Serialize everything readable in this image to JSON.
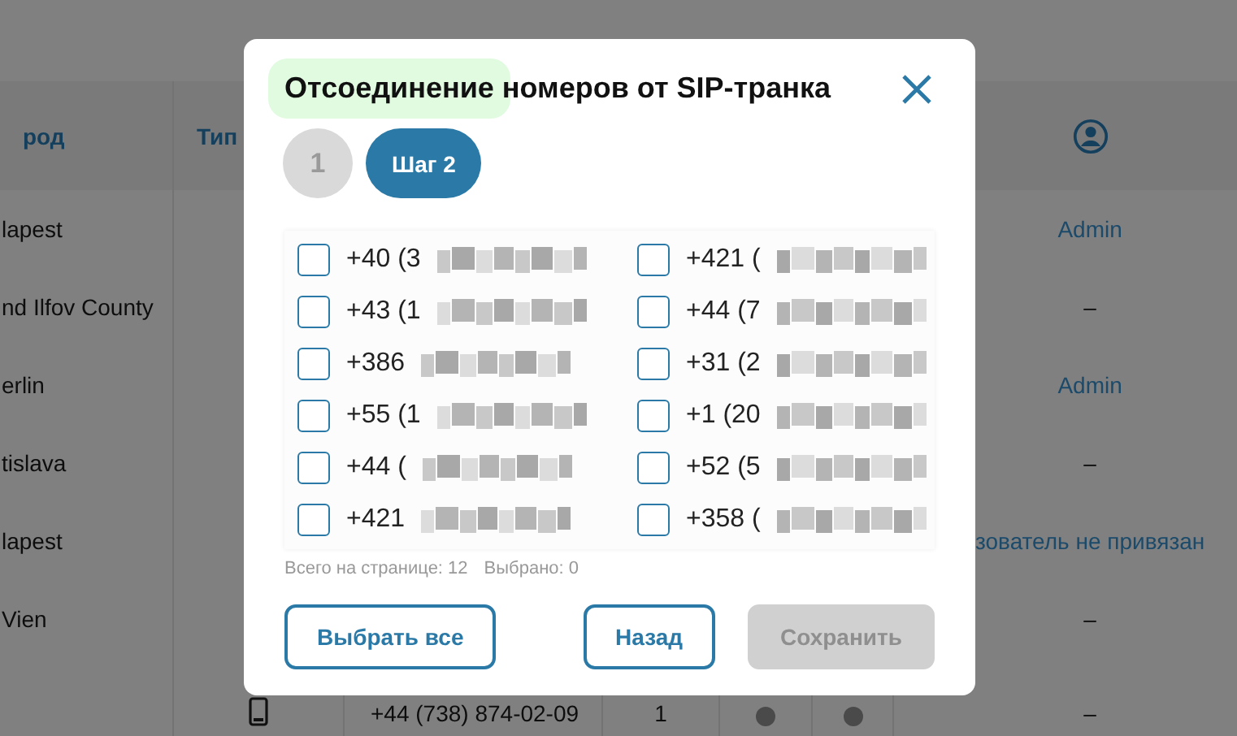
{
  "background_table": {
    "columns": [
      {
        "kind": "text",
        "label": "род"
      },
      {
        "kind": "text",
        "label": "Тип"
      },
      {
        "kind": "blank"
      },
      {
        "kind": "blank"
      },
      {
        "kind": "blank"
      },
      {
        "kind": "blank"
      },
      {
        "kind": "user-icon"
      }
    ],
    "rows": [
      {
        "city": "lapest",
        "user": "Admin"
      },
      {
        "city": "nd Ilfov County",
        "user": "–"
      },
      {
        "city": "erlin",
        "user": "Admin"
      },
      {
        "city": "tislava",
        "user": "–"
      },
      {
        "city": "lapest",
        "user": "зователь не привязан"
      },
      {
        "city": "Vien",
        "user": "–"
      },
      {
        "city": "",
        "phone_icon": true,
        "number": "+44 (738) 874-02-09",
        "count": "1",
        "user": "–"
      }
    ]
  },
  "dialog": {
    "title_parts": [
      {
        "text": "Отсоединение",
        "highlighted": true
      },
      {
        "text": " номеров от SIP-транка",
        "highlighted": false
      }
    ],
    "steps": [
      {
        "label": "1",
        "selected": false
      },
      {
        "label": "Шаг 2",
        "selected": true
      }
    ],
    "numbers": [
      {
        "text": "+40 (3",
        "checked": false
      },
      {
        "text": "+421 (",
        "checked": false
      },
      {
        "text": "+43 (1",
        "checked": false
      },
      {
        "text": "+44 (7",
        "checked": false
      },
      {
        "text": "+386",
        "checked": false
      },
      {
        "text": "+31 (2",
        "checked": false
      },
      {
        "text": "+55 (1",
        "checked": false
      },
      {
        "text": "+1 (20",
        "checked": false
      },
      {
        "text": "+44 (",
        "checked": false
      },
      {
        "text": "+52 (5",
        "checked": false
      },
      {
        "text": "+421",
        "checked": false
      },
      {
        "text": "+358 (",
        "checked": false
      }
    ],
    "total": "Всего на странице: 12",
    "selected_count": "Выбрано: 0",
    "buttons": [
      {
        "label": "Выбрать все",
        "disabled": false
      },
      {
        "label": "Назад",
        "disabled": false
      },
      {
        "label": "Сохранить",
        "disabled": true
      }
    ]
  }
}
